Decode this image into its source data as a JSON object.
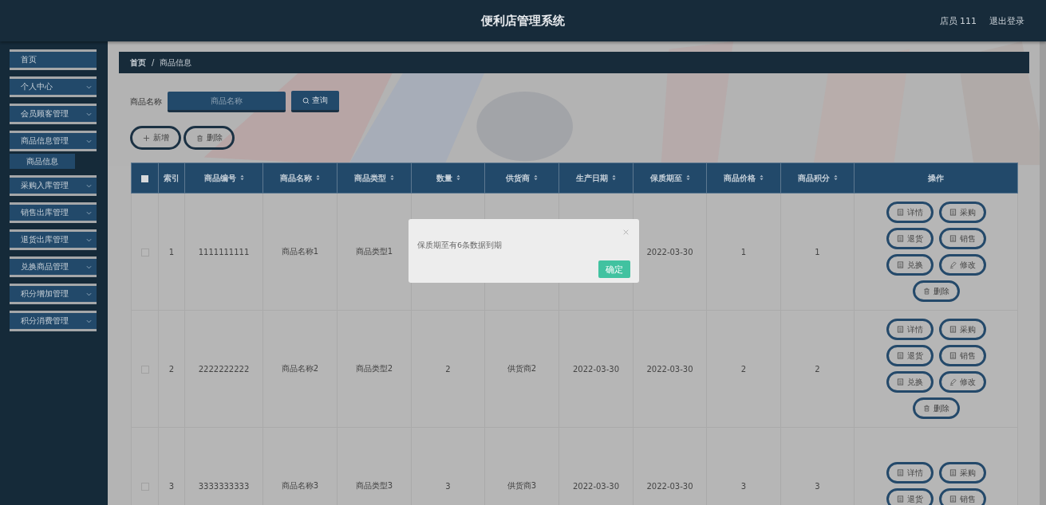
{
  "header": {
    "title": "便利店管理系统",
    "user": "店员 111",
    "logout": "退出登录"
  },
  "sidebar": {
    "items": [
      {
        "label": "首页",
        "kind": "link"
      },
      {
        "label": "个人中心",
        "kind": "menu"
      },
      {
        "label": "会员顾客管理",
        "kind": "menu"
      },
      {
        "label": "商品信息管理",
        "kind": "menu",
        "children": [
          {
            "label": "商品信息",
            "selected": true
          }
        ]
      },
      {
        "label": "采购入库管理",
        "kind": "menu"
      },
      {
        "label": "销售出库管理",
        "kind": "menu"
      },
      {
        "label": "退货出库管理",
        "kind": "menu"
      },
      {
        "label": "兑换商品管理",
        "kind": "menu"
      },
      {
        "label": "积分增加管理",
        "kind": "menu"
      },
      {
        "label": "积分消费管理",
        "kind": "menu"
      }
    ]
  },
  "breadcrumb": {
    "separator": "/",
    "items": [
      "首页",
      "商品信息"
    ]
  },
  "search": {
    "label": "商品名称",
    "placeholder": "商品名称",
    "button": "查询"
  },
  "toolbar": [
    {
      "label": "新增",
      "kind": "add"
    },
    {
      "label": "删除",
      "kind": "delete"
    }
  ],
  "table": {
    "header_checked": false,
    "columns": [
      {
        "label": "索引",
        "sortable": false
      },
      {
        "label": "商品编号",
        "sortable": true
      },
      {
        "label": "商品名称",
        "sortable": true
      },
      {
        "label": "商品类型",
        "sortable": true
      },
      {
        "label": "数量",
        "sortable": true
      },
      {
        "label": "供货商",
        "sortable": true
      },
      {
        "label": "生产日期",
        "sortable": true
      },
      {
        "label": "保质期至",
        "sortable": true
      },
      {
        "label": "商品价格",
        "sortable": true
      },
      {
        "label": "商品积分",
        "sortable": true
      },
      {
        "label": "操作",
        "sortable": false
      }
    ],
    "rows": [
      {
        "checked": false,
        "cells": [
          "1",
          "1111111111",
          "商品名称1",
          "商品类型1",
          null,
          null,
          null,
          "2022-03-30",
          "1",
          "1"
        ],
        "actions": [
          {
            "label": "详情",
            "kind": "doc"
          },
          {
            "label": "采购",
            "kind": "doc"
          },
          {
            "label": "退货",
            "kind": "doc"
          },
          {
            "label": "销售",
            "kind": "doc"
          },
          {
            "label": "兑换",
            "kind": "doc"
          },
          {
            "label": "修改",
            "kind": "edit"
          },
          {
            "label": "删除",
            "kind": "delete"
          }
        ]
      },
      {
        "checked": false,
        "cells": [
          "2",
          "2222222222",
          "商品名称2",
          "商品类型2",
          "2",
          "供货商2",
          "2022-03-30",
          "2022-03-30",
          "2",
          "2"
        ],
        "actions": [
          {
            "label": "详情",
            "kind": "doc"
          },
          {
            "label": "采购",
            "kind": "doc"
          },
          {
            "label": "退货",
            "kind": "doc"
          },
          {
            "label": "销售",
            "kind": "doc"
          },
          {
            "label": "兑换",
            "kind": "doc"
          },
          {
            "label": "修改",
            "kind": "edit"
          },
          {
            "label": "删除",
            "kind": "delete"
          }
        ]
      },
      {
        "checked": false,
        "cells": [
          "3",
          "3333333333",
          "商品名称3",
          "商品类型3",
          "3",
          "供货商3",
          "2022-03-30",
          "2022-03-30",
          "3",
          "3"
        ],
        "actions": [
          {
            "label": "详情",
            "kind": "doc"
          },
          {
            "label": "采购",
            "kind": "doc"
          },
          {
            "label": "退货",
            "kind": "doc"
          },
          {
            "label": "销售",
            "kind": "doc"
          }
        ]
      }
    ]
  },
  "dialog": {
    "message": "保质期至有6条数据到期",
    "confirm": "确定"
  }
}
